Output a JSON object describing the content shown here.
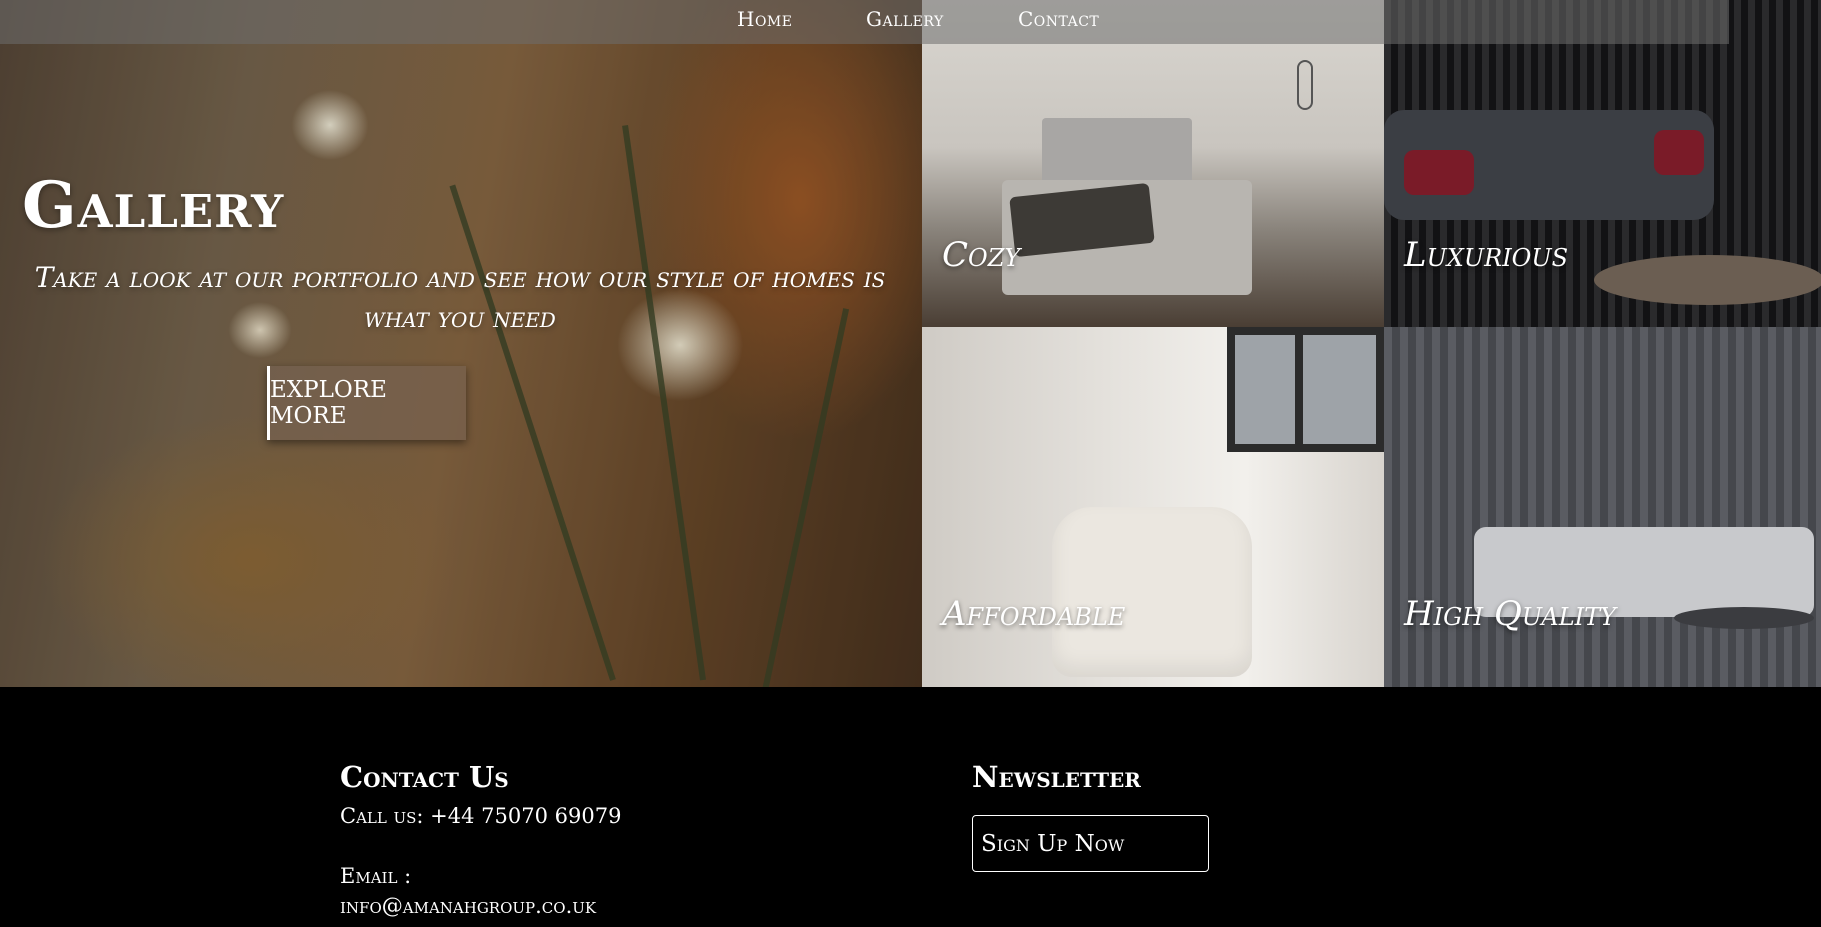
{
  "nav": {
    "items": [
      {
        "label": "Home"
      },
      {
        "label": "Gallery"
      },
      {
        "label": "Contact"
      }
    ]
  },
  "hero": {
    "title": "Gallery",
    "subtitle": "Take a look at our portfolio and see how our style of homes is what you need",
    "button_label": "EXPLORE MORE"
  },
  "tiles": [
    {
      "label": "Cozy"
    },
    {
      "label": "Luxurious"
    },
    {
      "label": "Affordable"
    },
    {
      "label": "High Quality"
    }
  ],
  "footer": {
    "contact": {
      "title": "Contact Us",
      "phone": "Call us: +44 75070 69079",
      "email_label": "Email :",
      "email": "info@amanahgroup.co.uk"
    },
    "newsletter": {
      "title": "Newsletter",
      "button_label": "Sign Up Now"
    }
  }
}
